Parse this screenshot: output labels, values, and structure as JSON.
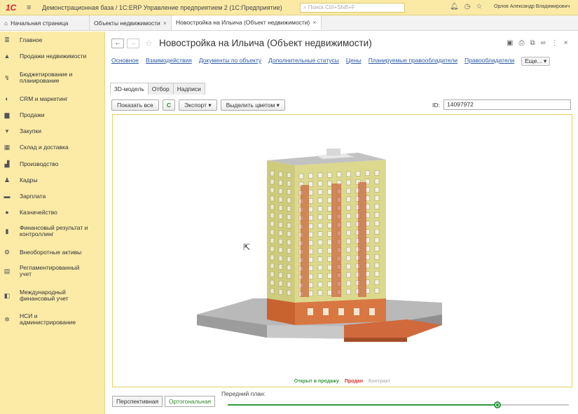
{
  "titlebar": {
    "logo": "1С",
    "app_title": "Демонстрационная база / 1С:ERP Управление предприятием 2  (1С:Предприятие)",
    "search_placeholder": "Поиск Ctrl+Shift+F",
    "user": "Орлов Александр Владимирович"
  },
  "tabs": {
    "home": "Начальная страница",
    "items": [
      {
        "label": "Объекты недвижимости"
      },
      {
        "label": "Новостройка на Ильича (Объект недвижимости)"
      }
    ]
  },
  "sidebar": {
    "items": [
      {
        "label": "Главное",
        "icon": "menu-icon"
      },
      {
        "label": "Продажи недвижимости",
        "icon": "house-icon"
      },
      {
        "label": "Бюджетирование и планирование",
        "icon": "budget-icon"
      },
      {
        "label": "CRM и маркетинг",
        "icon": "crm-icon"
      },
      {
        "label": "Продажи",
        "icon": "bag-icon"
      },
      {
        "label": "Закупки",
        "icon": "cart-icon"
      },
      {
        "label": "Склад и доставка",
        "icon": "warehouse-icon"
      },
      {
        "label": "Производство",
        "icon": "factory-icon"
      },
      {
        "label": "Кадры",
        "icon": "person-icon"
      },
      {
        "label": "Зарплата",
        "icon": "money-icon"
      },
      {
        "label": "Казначейство",
        "icon": "treasury-icon"
      },
      {
        "label": "Финансовый результат и контроллинг",
        "icon": "chart-icon"
      },
      {
        "label": "Внеоборотные активы",
        "icon": "assets-icon"
      },
      {
        "label": "Регламентированный учет",
        "icon": "doc-icon"
      },
      {
        "label": "Международный финансовый учет",
        "icon": "intl-icon"
      },
      {
        "label": "НСИ и администрирование",
        "icon": "gear-icon"
      }
    ]
  },
  "header": {
    "title": "Новостройка на Ильича (Объект недвижимости)"
  },
  "links": [
    "Основное",
    "Взаимодействия",
    "Документы по объекту",
    "Дополнительные статусы",
    "Цены",
    "Планируемые правообладатели",
    "Правообладатели"
  ],
  "more_label": "Еще...",
  "subtabs": [
    "3D-модель",
    "Отбор",
    "Надписи"
  ],
  "toolbar": {
    "show_all": "Показать все",
    "refresh": "C",
    "export": "Экспорт",
    "highlight": "Выделить цветом",
    "id_label": "ID:",
    "id_value": "14097972"
  },
  "legend": {
    "open": "Открыт в продажу",
    "sold": "Продан",
    "contract": "Контракт"
  },
  "bottom": {
    "perspective": "Перспективная",
    "orthogonal": "Ортогональная",
    "foreground_label": "Передний план:",
    "slider_value": 0.79
  },
  "colors": {
    "facade": "#d8d58a",
    "base": "#c86a3a",
    "accent_green": "#2c9a3c",
    "sidebar_bg": "#fbeba7"
  }
}
